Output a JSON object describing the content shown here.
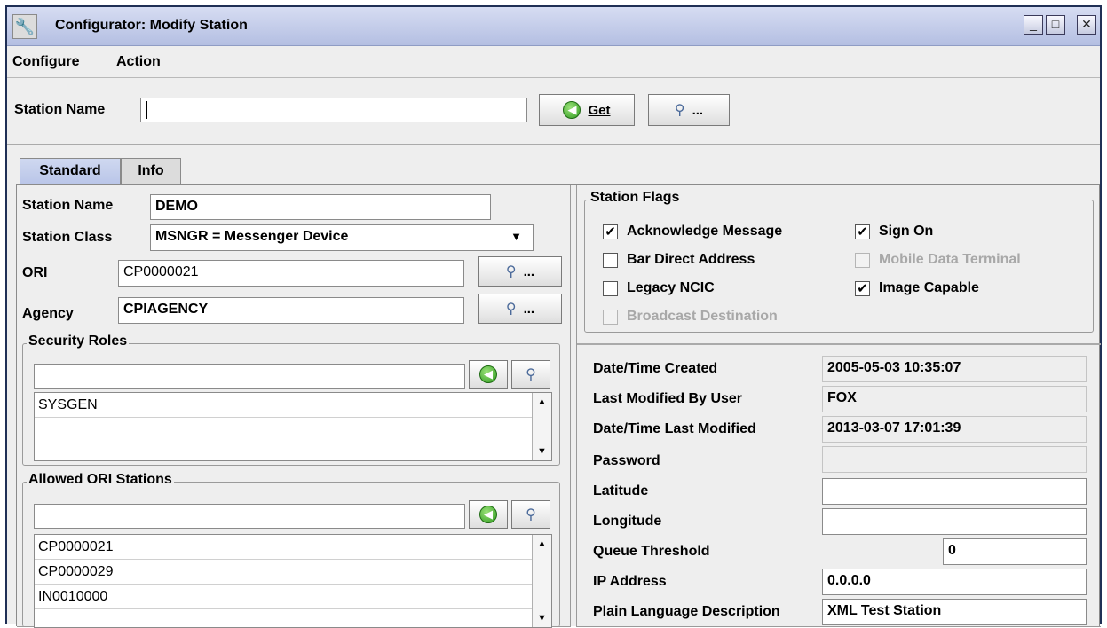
{
  "window": {
    "title": "Configurator: Modify Station",
    "icon": "wrench-icon",
    "controls": [
      "minimize-icon",
      "maximize-icon",
      "close-icon"
    ]
  },
  "menu": {
    "configure": "Configure",
    "action": "Action"
  },
  "toolbar": {
    "station_name_label": "Station Name",
    "station_name_value": "",
    "get_label": "Get",
    "lookup_label": "..."
  },
  "tabs": {
    "standard": "Standard",
    "info": "Info"
  },
  "standard": {
    "station_name_label": "Station Name",
    "station_name_value": "DEMO",
    "station_class_label": "Station Class",
    "station_class_value": "MSNGR = Messenger Device",
    "ori_label": "ORI",
    "ori_value": "CP0000021",
    "agency_label": "Agency",
    "agency_value": "CPIAGENCY",
    "lookup_label": "..."
  },
  "security_roles": {
    "title": "Security Roles",
    "input_value": "",
    "items": [
      "SYSGEN"
    ]
  },
  "allowed_ori": {
    "title": "Allowed ORI Stations",
    "input_value": "",
    "items": [
      "CP0000021",
      "CP0000029",
      "IN0010000"
    ]
  },
  "station_flags": {
    "title": "Station Flags",
    "acknowledge_message": "Acknowledge Message",
    "sign_on": "Sign On",
    "bar_direct_address": "Bar Direct Address",
    "mobile_data_terminal": "Mobile Data Terminal",
    "legacy_ncic": "Legacy NCIC",
    "image_capable": "Image Capable",
    "broadcast_destination": "Broadcast Destination"
  },
  "details": {
    "created_label": "Date/Time Created",
    "created_value": "2005-05-03 10:35:07",
    "modified_by_label": "Last Modified By User",
    "modified_by_value": "FOX",
    "last_modified_label": "Date/Time Last Modified",
    "last_modified_value": "2013-03-07 17:01:39",
    "password_label": "Password",
    "password_value": "",
    "latitude_label": "Latitude",
    "latitude_value": "",
    "longitude_label": "Longitude",
    "longitude_value": "",
    "queue_label": "Queue Threshold",
    "queue_value": "0",
    "ip_label": "IP Address",
    "ip_value": "0.0.0.0",
    "description_label": "Plain Language Description",
    "description_value": "XML Test Station"
  }
}
